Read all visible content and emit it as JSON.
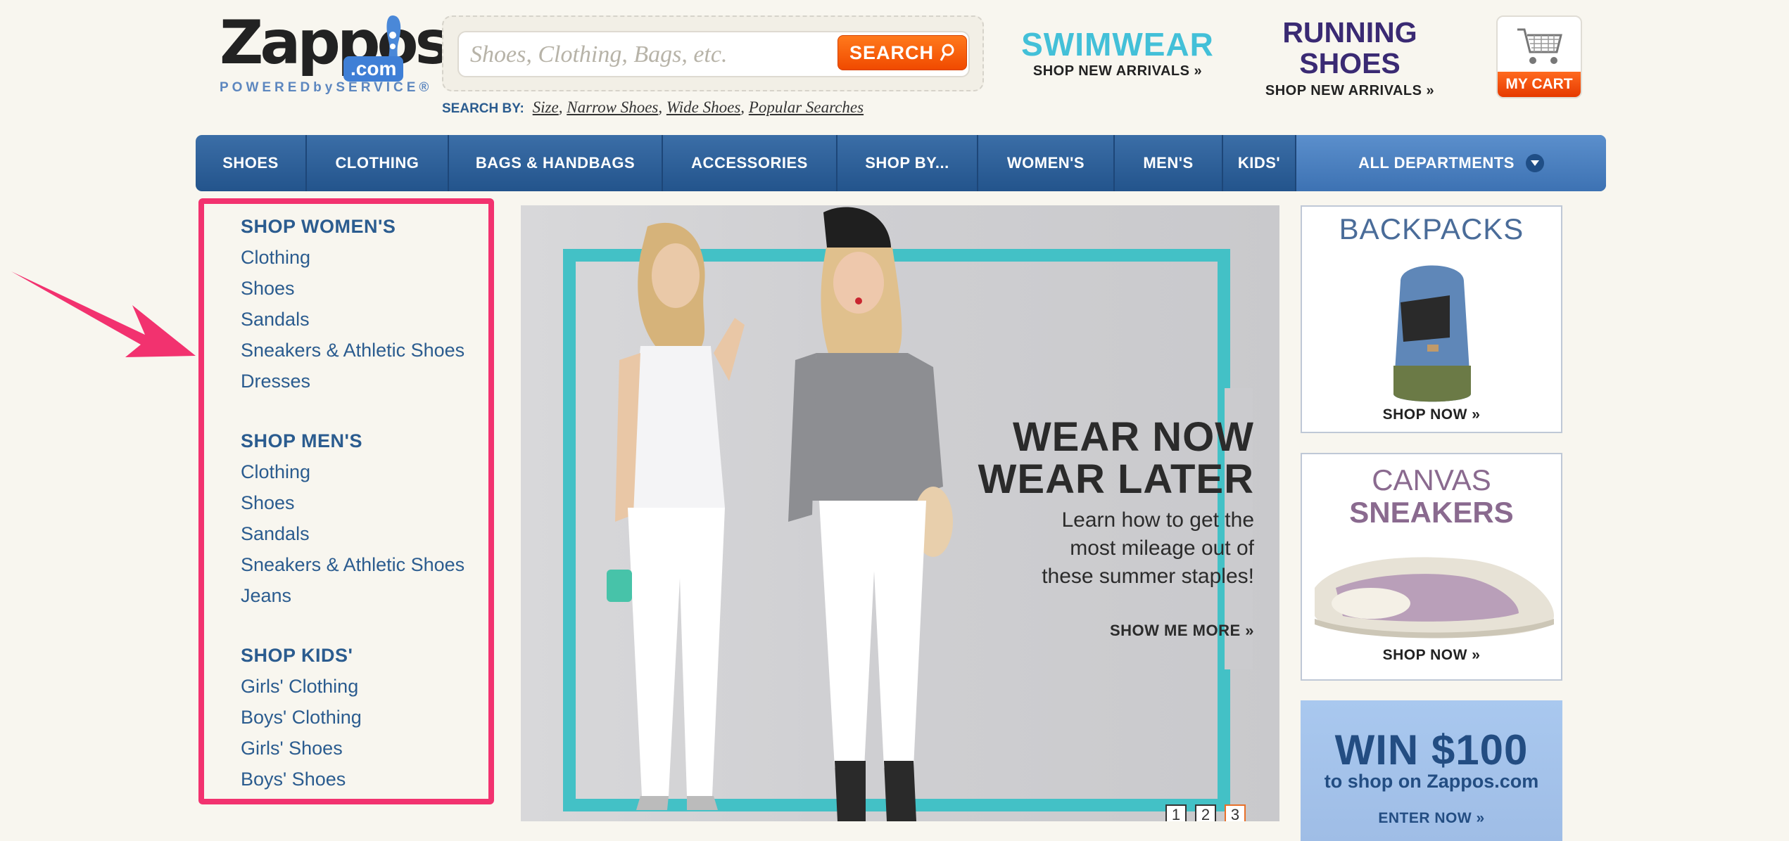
{
  "header": {
    "logo": {
      "word": "Zappos",
      "com": ".com",
      "tagline": "POWEREDbySERVICE®"
    },
    "search": {
      "placeholder": "Shoes, Clothing, Bags, etc.",
      "button_label": "SEARCH",
      "by_label": "SEARCH BY:",
      "by_links": [
        "Size",
        "Narrow Shoes",
        "Wide Shoes",
        "Popular Searches"
      ]
    },
    "promos": [
      {
        "title": "SWIMWEAR",
        "subtitle": "SHOP NEW ARRIVALS »"
      },
      {
        "title_line1": "RUNNING",
        "title_line2": "SHOES",
        "subtitle": "SHOP NEW ARRIVALS »"
      }
    ],
    "cart": {
      "label": "MY CART"
    }
  },
  "nav": {
    "items": [
      "SHOES",
      "CLOTHING",
      "BAGS & HANDBAGS",
      "ACCESSORIES",
      "SHOP BY...",
      "WOMEN'S",
      "MEN'S",
      "KIDS'"
    ],
    "all_label": "ALL DEPARTMENTS"
  },
  "sidebar": {
    "sections": [
      {
        "heading": "SHOP WOMEN'S",
        "links": [
          "Clothing",
          "Shoes",
          "Sandals",
          "Sneakers & Athletic Shoes",
          "Dresses"
        ]
      },
      {
        "heading": "SHOP MEN'S",
        "links": [
          "Clothing",
          "Shoes",
          "Sandals",
          "Sneakers & Athletic Shoes",
          "Jeans"
        ]
      },
      {
        "heading": "SHOP KIDS'",
        "links": [
          "Girls' Clothing",
          "Boys' Clothing",
          "Girls' Shoes",
          "Boys' Shoes"
        ]
      }
    ]
  },
  "hero": {
    "title_line1": "WEAR NOW",
    "title_line2": "WEAR LATER",
    "body_line1": "Learn how to get the",
    "body_line2": "most mileage out of",
    "body_line3": "these summer staples!",
    "cta": "SHOW ME MORE »",
    "pages": [
      "1",
      "2",
      "3"
    ],
    "active_page": "3"
  },
  "ads": [
    {
      "title": "BACKPACKS",
      "cta": "SHOP NOW »"
    },
    {
      "title_line1": "CANVAS",
      "title_line2": "SNEAKERS",
      "cta": "SHOP NOW »"
    },
    {
      "title": "WIN $100",
      "subtitle": "to shop on Zappos.com",
      "cta": "ENTER NOW »"
    }
  ],
  "colors": {
    "page_bg": "#f8f6ef",
    "link_blue": "#2b5c8f",
    "nav_blue": "#2b5e96",
    "search_orange": "#f05a0a",
    "highlight_pink": "#f2326f",
    "teal": "#43c1c6",
    "purple": "#3a2a73"
  },
  "annotation": {
    "type": "pink-arrow-and-box",
    "target": "sidebar"
  }
}
